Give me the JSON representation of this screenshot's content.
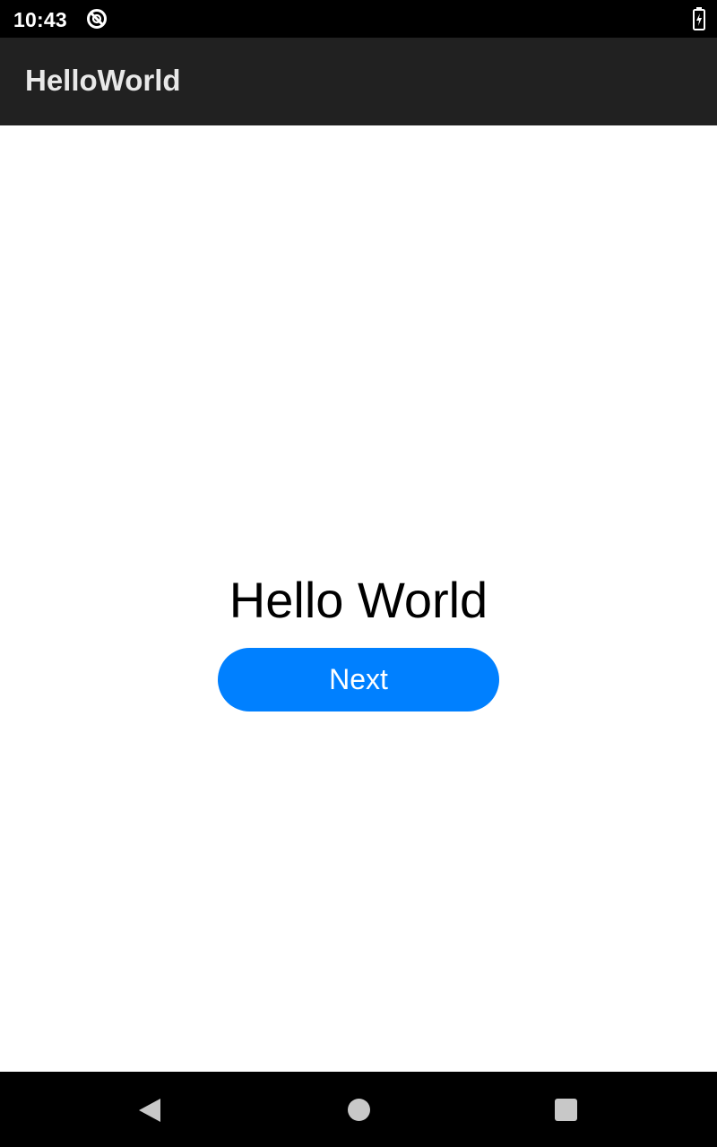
{
  "status_bar": {
    "time": "10:43",
    "icons": [
      "sync-icon",
      "battery-charging-icon"
    ]
  },
  "app_bar": {
    "title": "HelloWorld"
  },
  "main": {
    "greeting": "Hello World",
    "next_button_label": "Next"
  },
  "nav_bar": {
    "icons": [
      "back-icon",
      "home-icon",
      "recents-icon"
    ]
  },
  "colors": {
    "status_bar": "#000000",
    "app_bar": "#212121",
    "accent": "#0080ff",
    "background": "#ffffff",
    "nav_bar": "#000000"
  }
}
